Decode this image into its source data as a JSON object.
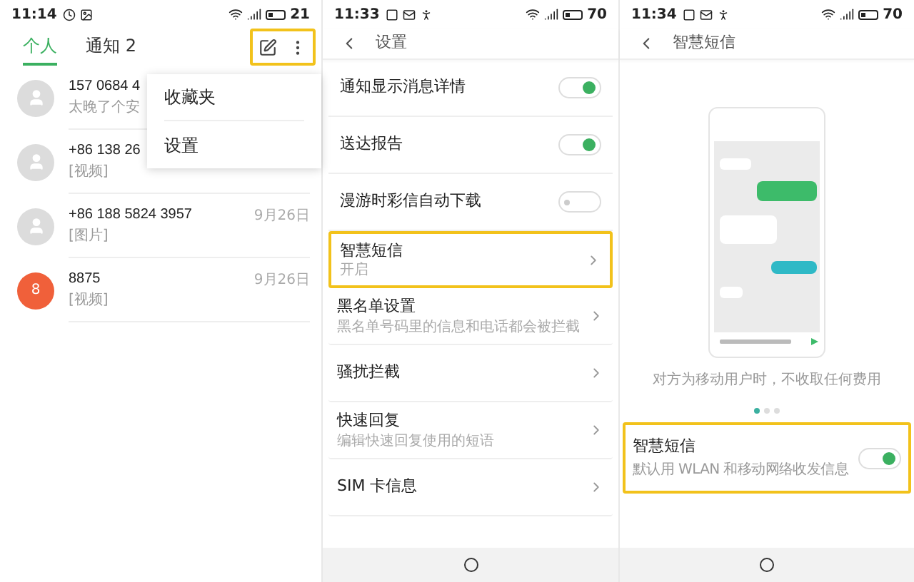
{
  "messages_screen": {
    "status": {
      "time": "11:14",
      "battery": "21"
    },
    "tabs": [
      {
        "label": "个人",
        "selected": true
      },
      {
        "label": "通知 2",
        "selected": false
      }
    ],
    "actions_highlighted": true,
    "conversations": [
      {
        "name": "157 0684 4",
        "preview": "太晚了个安",
        "avatar": {
          "kind": "silhouette"
        }
      },
      {
        "name": "+86 138 26",
        "preview": "[视频]",
        "avatar": {
          "kind": "silhouette"
        }
      },
      {
        "name": "+86 188 5824 3957",
        "preview": "[图片]",
        "date": "9月26日",
        "avatar": {
          "kind": "silhouette"
        }
      },
      {
        "name": "8875",
        "preview": "[视频]",
        "date": "9月26日",
        "avatar": {
          "kind": "letter",
          "letter": "8",
          "color": "#f0603a"
        }
      }
    ],
    "menu": {
      "items": [
        "收藏夹",
        "设置"
      ]
    }
  },
  "settings_screen": {
    "status": {
      "time": "11:33",
      "battery": "70"
    },
    "title": "设置",
    "rows": [
      {
        "kind": "toggle",
        "label": "通知显示消息详情",
        "on": true
      },
      {
        "kind": "toggle",
        "label": "送达报告",
        "on": true
      },
      {
        "kind": "toggle",
        "label": "漫游时彩信自动下载",
        "on": false
      },
      {
        "kind": "link",
        "label": "智慧短信",
        "sub": "开启",
        "highlighted": true
      },
      {
        "kind": "link",
        "label": "黑名单设置",
        "sub": "黑名单号码里的信息和电话都会被拦截",
        "highlighted": false
      },
      {
        "kind": "link",
        "label": "骚扰拦截",
        "highlighted": false
      },
      {
        "kind": "link",
        "label": "快速回复",
        "sub": "编辑快速回复使用的短语",
        "highlighted": false
      },
      {
        "kind": "link",
        "label": "SIM 卡信息",
        "highlighted": false
      }
    ]
  },
  "smart_sms_screen": {
    "status": {
      "time": "11:34",
      "battery": "70"
    },
    "title": "智慧短信",
    "caption": "对方为移动用户时，不收取任何费用",
    "pages": [
      {
        "selected": true
      },
      {
        "selected": false
      },
      {
        "selected": false
      }
    ],
    "setting": {
      "label": "智慧短信",
      "sub": "默认用 WLAN 和移动网络收发信息",
      "on": true,
      "highlighted": true
    }
  }
}
